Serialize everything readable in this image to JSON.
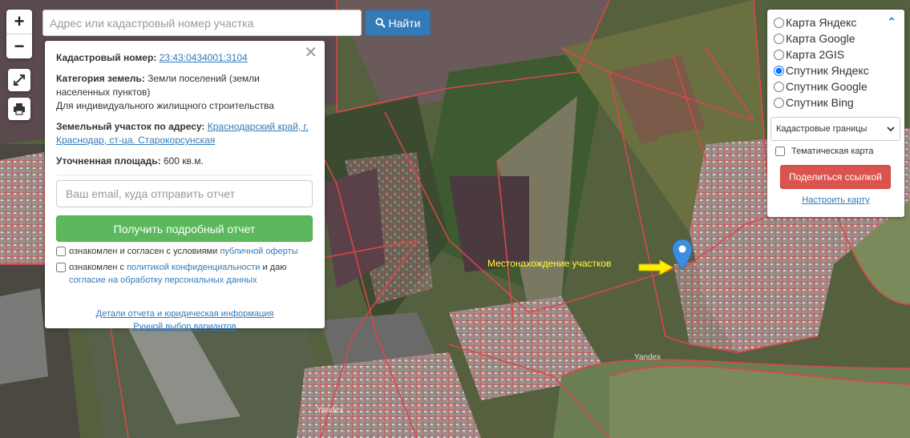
{
  "search": {
    "placeholder": "Адрес или кадастровый номер участка",
    "button_label": "Найти"
  },
  "zoom": {
    "in": "+",
    "out": "−"
  },
  "info": {
    "cadastral_label": "Кадастровый номер:",
    "cadastral_value": "23:43:0434001:3104",
    "category_label": "Категория земель:",
    "category_value": "Земли поселений (земли населенных пунктов)",
    "usage": "Для индивидуального жилищного строительства",
    "address_label": "Земельный участок по адресу:",
    "address_value": "Краснодарский край, г. Краснодар, ст-ца. Старокорсунская",
    "area_label": "Уточненная площадь:",
    "area_value": "600 кв.м.",
    "email_placeholder": "Ваш email, куда отправить отчет",
    "report_button": "Получить подробный отчет",
    "consent1_text": "ознакомлен и согласен с условиями ",
    "consent1_link": "публичной оферты",
    "consent2_text": "ознакомлен с ",
    "consent2_link": "политикой конфиденциальности",
    "consent2_mid": " и даю ",
    "consent2_link2": "согласие на обработку персональных данных",
    "details_link": "Детали отчета и юридическая информация",
    "manual_link": "Ручной выбор вариантов"
  },
  "layers": {
    "options": [
      {
        "label": "Карта Яндекс",
        "checked": false
      },
      {
        "label": "Карта Google",
        "checked": false
      },
      {
        "label": "Карта 2GIS",
        "checked": false
      },
      {
        "label": "Спутник Яндекс",
        "checked": true
      },
      {
        "label": "Спутник Google",
        "checked": false
      },
      {
        "label": "Спутник Bing",
        "checked": false
      }
    ],
    "overlay_select": "Кадастровые границы",
    "thematic_label": "Тематическая карта",
    "share_button": "Поделиться ссылкой",
    "setup_link": "Настроить карту"
  },
  "map": {
    "annotation": "Местонахождение участков",
    "watermark": "Yandex",
    "colors": {
      "boundary": "#d9474a",
      "marker": "#3b8ee0",
      "arrow": "#ffee00"
    }
  }
}
